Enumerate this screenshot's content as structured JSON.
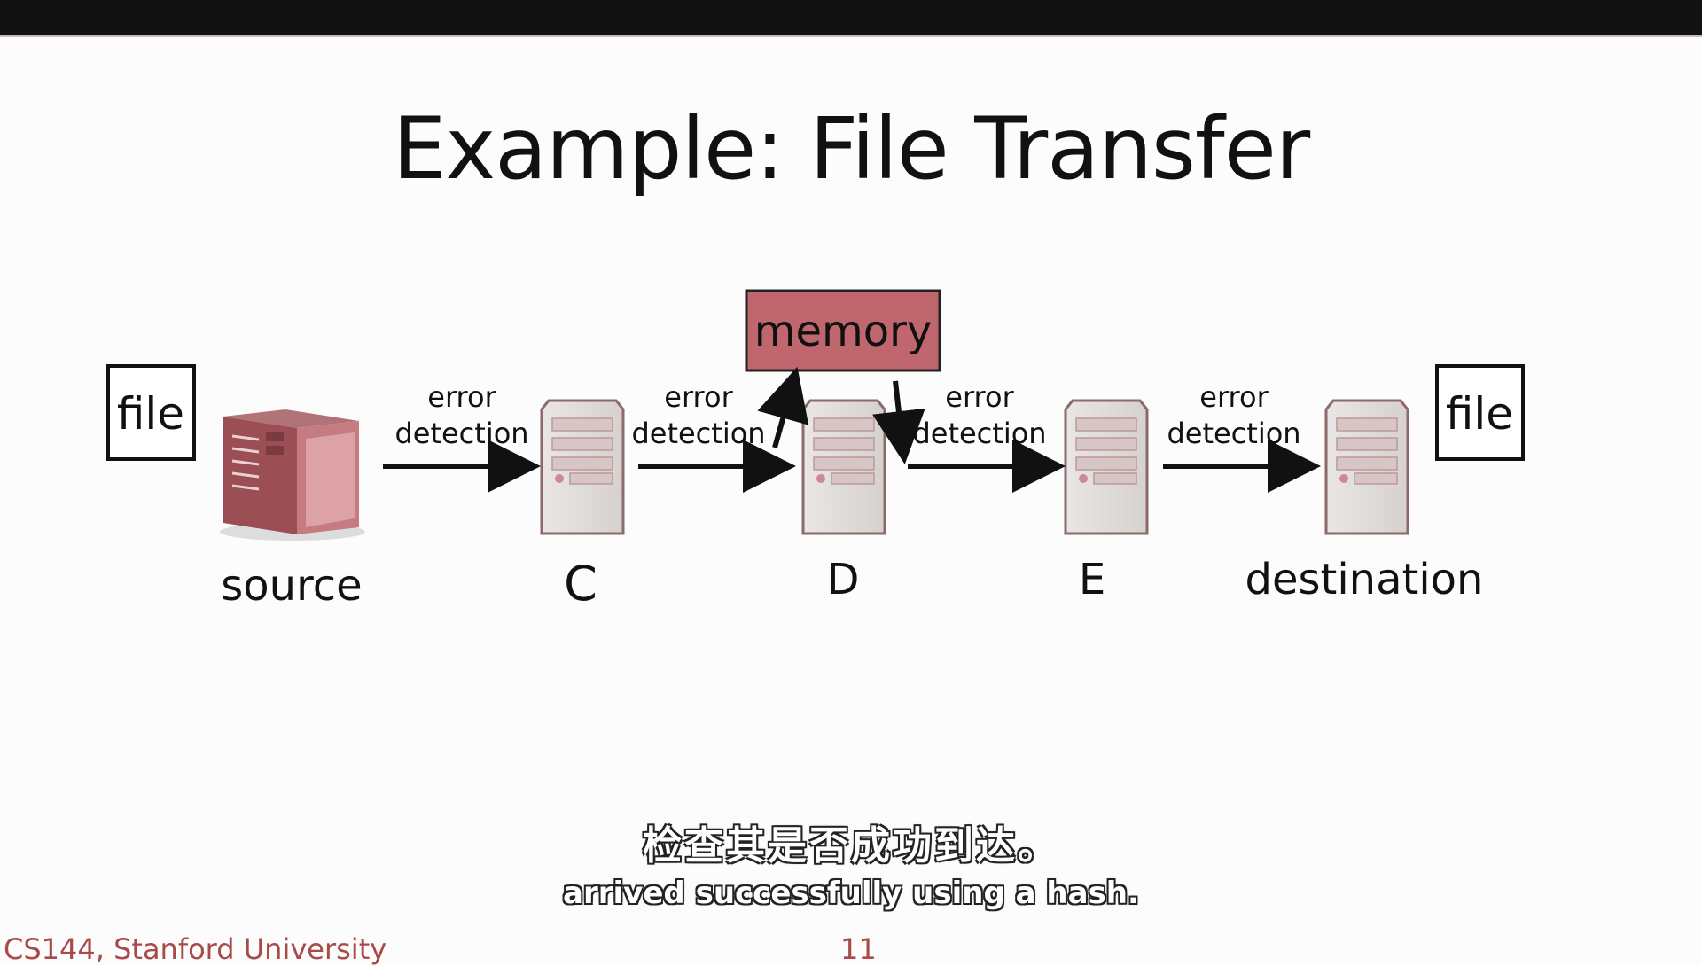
{
  "slide": {
    "title": "Example: File Transfer",
    "footer": "CS144, Stanford University",
    "page_number": "11"
  },
  "diagram": {
    "file_left": "file",
    "file_right": "file",
    "memory": "memory",
    "nodes": [
      "source",
      "C",
      "D",
      "E",
      "destination"
    ],
    "link_labels": [
      {
        "line1": "error",
        "line2": "detection"
      },
      {
        "line1": "error",
        "line2": "detection"
      },
      {
        "line1": "error",
        "line2": "detection"
      },
      {
        "line1": "error",
        "line2": "detection"
      }
    ],
    "colors": {
      "memory_fill": "#c0666f",
      "server_accent": "#a0555b",
      "arrow": "#111111"
    }
  },
  "subtitles": {
    "zh": "检查其是否成功到达。",
    "en": "arrived successfully using a hash."
  }
}
